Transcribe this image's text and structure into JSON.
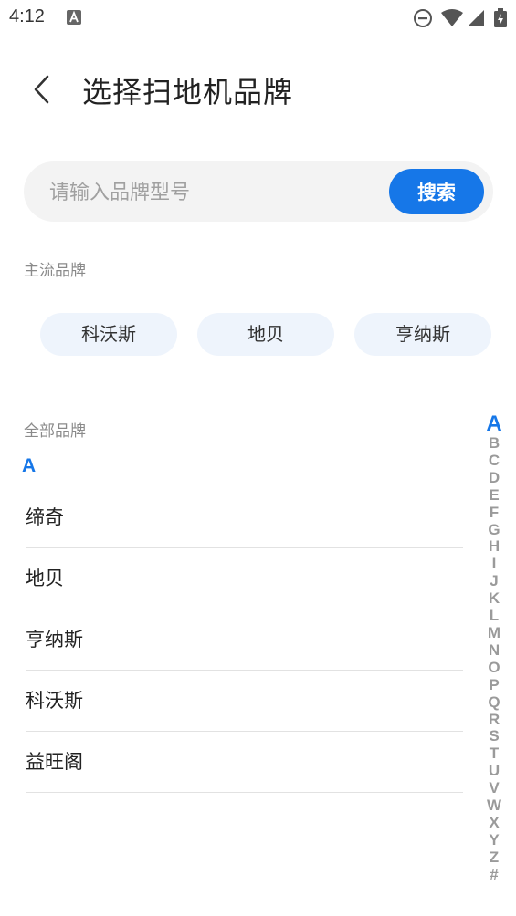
{
  "status_bar": {
    "time": "4:12"
  },
  "header": {
    "title": "选择扫地机品牌"
  },
  "search": {
    "placeholder": "请输入品牌型号",
    "value": "",
    "button_label": "搜索"
  },
  "popular": {
    "label": "主流品牌",
    "brands": [
      "科沃斯",
      "地贝",
      "亨纳斯"
    ]
  },
  "all": {
    "label": "全部品牌",
    "current_letter": "A",
    "brands": [
      "缔奇",
      "地贝",
      "亨纳斯",
      "科沃斯",
      "益旺阁"
    ]
  },
  "index": {
    "active": "A",
    "letters": [
      "A",
      "B",
      "C",
      "D",
      "E",
      "F",
      "G",
      "H",
      "I",
      "J",
      "K",
      "L",
      "M",
      "N",
      "O",
      "P",
      "Q",
      "R",
      "S",
      "T",
      "U",
      "V",
      "W",
      "X",
      "Y",
      "Z",
      "#"
    ]
  },
  "colors": {
    "accent": "#1677e8",
    "chip_bg": "#eef4fc",
    "search_bg": "#f3f3f3"
  }
}
